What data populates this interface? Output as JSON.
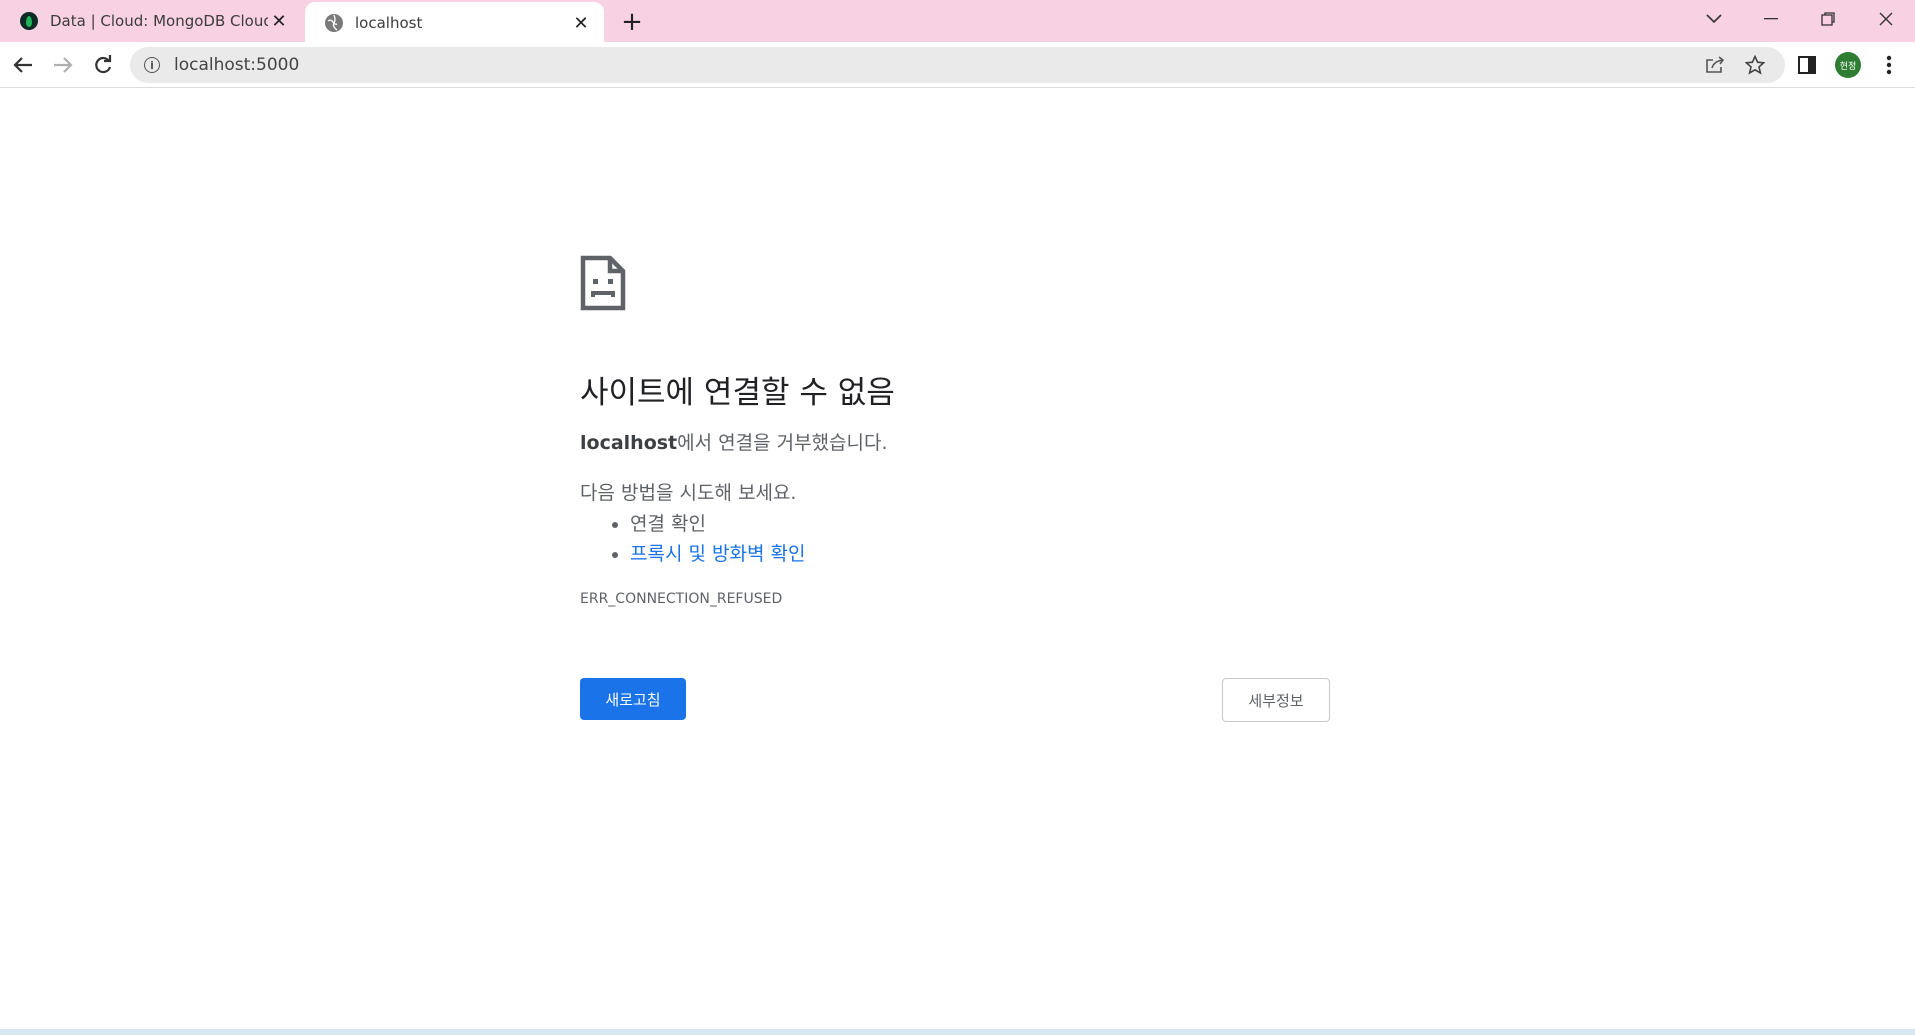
{
  "browser": {
    "tabs": [
      {
        "title": "Data | Cloud: MongoDB Cloud",
        "favicon": "mongodb-leaf-icon",
        "active": false
      },
      {
        "title": "localhost",
        "favicon": "globe-icon",
        "active": true
      }
    ],
    "new_tab_label": "+",
    "address": "localhost:5000",
    "profile_initials": "현정",
    "accent_color": "#f8d1e2"
  },
  "error_page": {
    "headline": "사이트에 연결할 수 없음",
    "host": "localhost",
    "summary_rest": "에서 연결을 거부했습니다.",
    "try_label": "다음 방법을 시도해 보세요.",
    "suggestions": [
      {
        "text": "연결 확인",
        "link": false
      },
      {
        "text": "프록시 및 방화벽 확인",
        "link": true
      }
    ],
    "error_code": "ERR_CONNECTION_REFUSED",
    "reload_label": "새로고침",
    "details_label": "세부정보",
    "primary_color": "#1a73e8"
  }
}
